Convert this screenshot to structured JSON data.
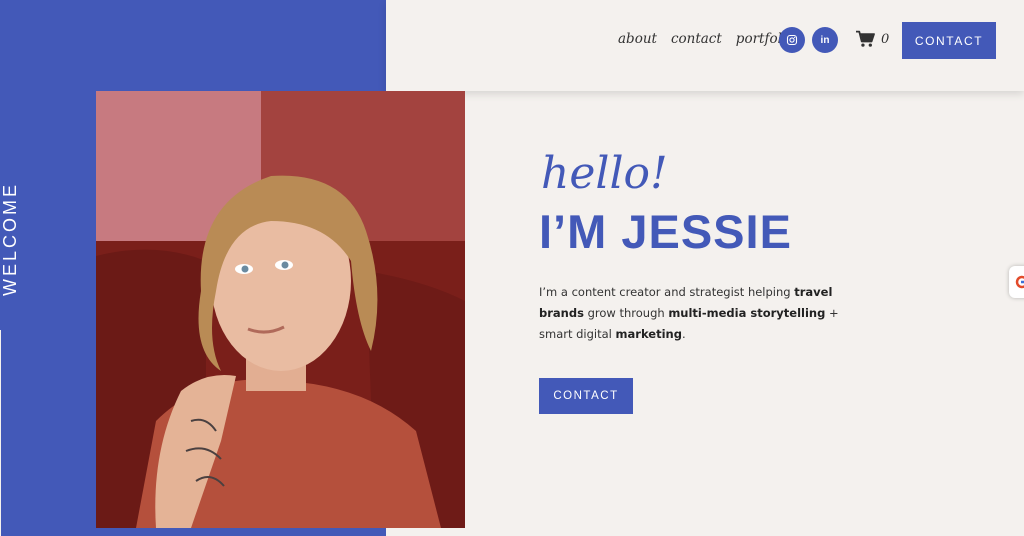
{
  "header": {
    "nav": [
      {
        "label": "about"
      },
      {
        "label": "contact"
      },
      {
        "label": "portfolio"
      }
    ],
    "social": [
      {
        "icon": "instagram-icon"
      },
      {
        "icon": "linkedin-icon",
        "label": "in"
      }
    ],
    "cart": {
      "icon": "shopping-cart-icon",
      "count": "0"
    },
    "contact_label": "CONTACT"
  },
  "side": {
    "welcome_text": "WELCOME"
  },
  "hero": {
    "greeting": "hello!",
    "name": "I’M JESSIE",
    "bio": {
      "part1": "I’m a content creator and strategist helping ",
      "bold1": "travel brands",
      "part2": " grow through ",
      "bold2": "multi-media storytelling",
      "part3": " + smart digital ",
      "bold3": "marketing",
      "part4": "."
    },
    "contact_label": "CONTACT"
  },
  "colors": {
    "brand_blue": "#4359b8",
    "background": "#f4f1ee",
    "text": "#333333"
  }
}
